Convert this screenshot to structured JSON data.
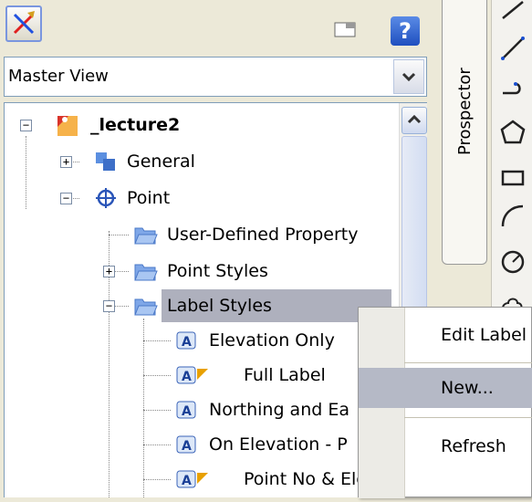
{
  "toolbar": {
    "tool_icon": "cross-pencil-icon",
    "dock_icon": "dock-icon",
    "help_label": "?"
  },
  "view_select": {
    "value": "Master View"
  },
  "tree": {
    "root": {
      "label": "_lecture2",
      "expander": "−"
    },
    "general": {
      "label": "General",
      "expander": "+"
    },
    "point": {
      "label": "Point",
      "expander": "−"
    },
    "user_defined": {
      "label": "User-Defined Property"
    },
    "point_styles": {
      "label": "Point Styles",
      "expander": "+"
    },
    "label_styles": {
      "label": "Label Styles",
      "expander": "−"
    },
    "items": [
      {
        "label": "Elevation Only"
      },
      {
        "label": "Full Label"
      },
      {
        "label": "Northing and Ea"
      },
      {
        "label": "On Elevation - P"
      },
      {
        "label": "Point No & Elev"
      }
    ]
  },
  "side_tab": {
    "label": "Prospector"
  },
  "context_menu": {
    "items": [
      {
        "label": "Edit Label"
      },
      {
        "label": "New..."
      },
      {
        "label": "Refresh"
      }
    ]
  },
  "colors": {
    "highlight": "#aeb0bd",
    "menu_hover": "#b5b9c6",
    "folder": "#7fa7e8"
  }
}
